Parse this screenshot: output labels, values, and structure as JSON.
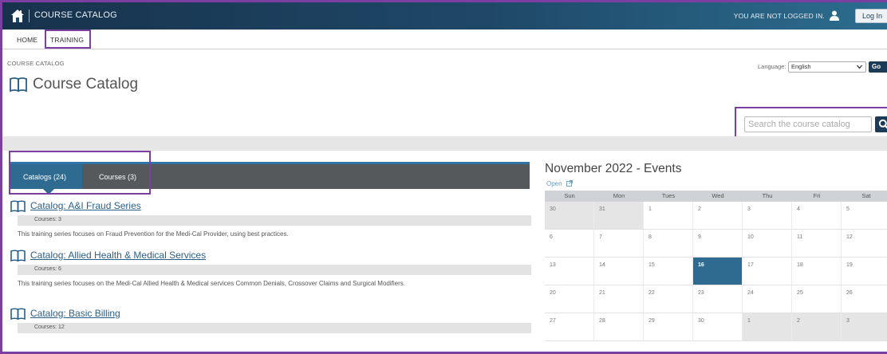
{
  "header": {
    "title": "COURSE CATALOG",
    "login_status": "YOU ARE NOT LOGGED IN.",
    "login_button": "Log In"
  },
  "nav": {
    "home": "HOME",
    "training": "TRAINING"
  },
  "breadcrumb": "COURSE CATALOG",
  "page_title": "Course Catalog",
  "language": {
    "label": "Language:",
    "selected": "English",
    "go_button": "Go"
  },
  "search": {
    "placeholder": "Search the course catalog"
  },
  "tabs": [
    {
      "label": "Catalogs (24)",
      "active": true
    },
    {
      "label": "Courses (3)",
      "active": false
    }
  ],
  "catalogs": [
    {
      "title": "Catalog: A&I Fraud Series",
      "count_label": "Courses:",
      "count": "3",
      "description": "This training series focuses on Fraud Prevention for the Medi-Cal Provider, using best practices."
    },
    {
      "title": "Catalog: Allied Health & Medical Services",
      "count_label": "Courses:",
      "count": "6",
      "description": "This training series focuses on the Medi-Cal Allied Health & Medical services Common Denials, Crossover Claims and Surgical Modifiers."
    },
    {
      "title": "Catalog: Basic Billing",
      "count_label": "Courses:",
      "count": "12",
      "description": ""
    }
  ],
  "events": {
    "title": "November 2022 - Events",
    "open_link": "Open",
    "weekdays": [
      "Sun",
      "Mon",
      "Tues",
      "Wed",
      "Thu",
      "Fri",
      "Sat"
    ],
    "weeks": [
      [
        "30",
        "31",
        "1",
        "2",
        "3",
        "4",
        "5"
      ],
      [
        "6",
        "7",
        "8",
        "9",
        "10",
        "11",
        "12"
      ],
      [
        "13",
        "14",
        "15",
        "16",
        "17",
        "18",
        "19"
      ],
      [
        "20",
        "21",
        "22",
        "23",
        "24",
        "25",
        "26"
      ],
      [
        "27",
        "28",
        "29",
        "30",
        "1",
        "2",
        "3"
      ]
    ],
    "today": "16"
  },
  "colors": {
    "header_dark": "#17324c",
    "accent_blue": "#2f6b91",
    "highlight_frame": "#7a3fa0",
    "tab_bar": "#55595c",
    "link": "#2c5f86"
  }
}
